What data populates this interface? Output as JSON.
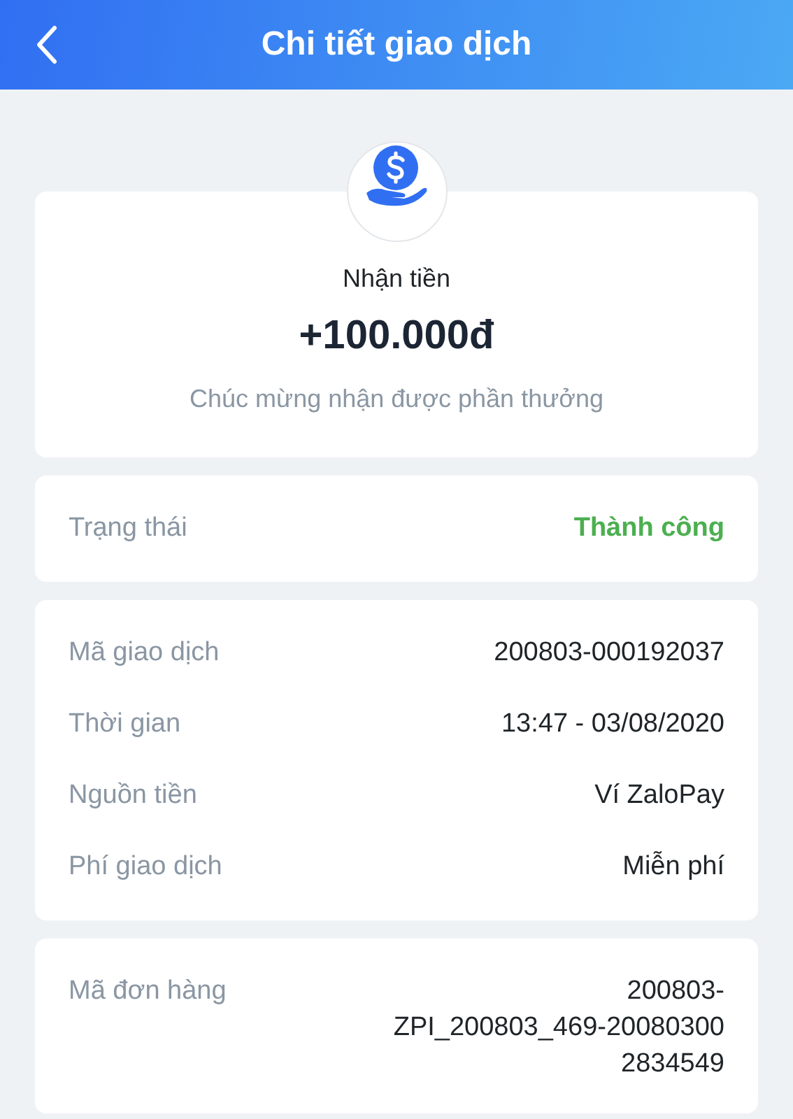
{
  "header": {
    "title": "Chi tiết giao dịch"
  },
  "summary": {
    "type": "Nhận tiền",
    "amount": "+100.000đ",
    "message": "Chúc mừng nhận được phần thưởng"
  },
  "status": {
    "label": "Trạng thái",
    "value": "Thành công",
    "kind": "success"
  },
  "details": [
    {
      "label": "Mã giao dịch",
      "value": "200803-000192037"
    },
    {
      "label": "Thời gian",
      "value": "13:47 - 03/08/2020"
    },
    {
      "label": "Nguồn tiền",
      "value": "Ví ZaloPay"
    },
    {
      "label": "Phí giao dịch",
      "value": "Miễn phí"
    }
  ],
  "order": {
    "label": "Mã đơn hàng",
    "value_lines": [
      "200803-",
      "ZPI_200803_469-20080300",
      "2834549"
    ]
  }
}
